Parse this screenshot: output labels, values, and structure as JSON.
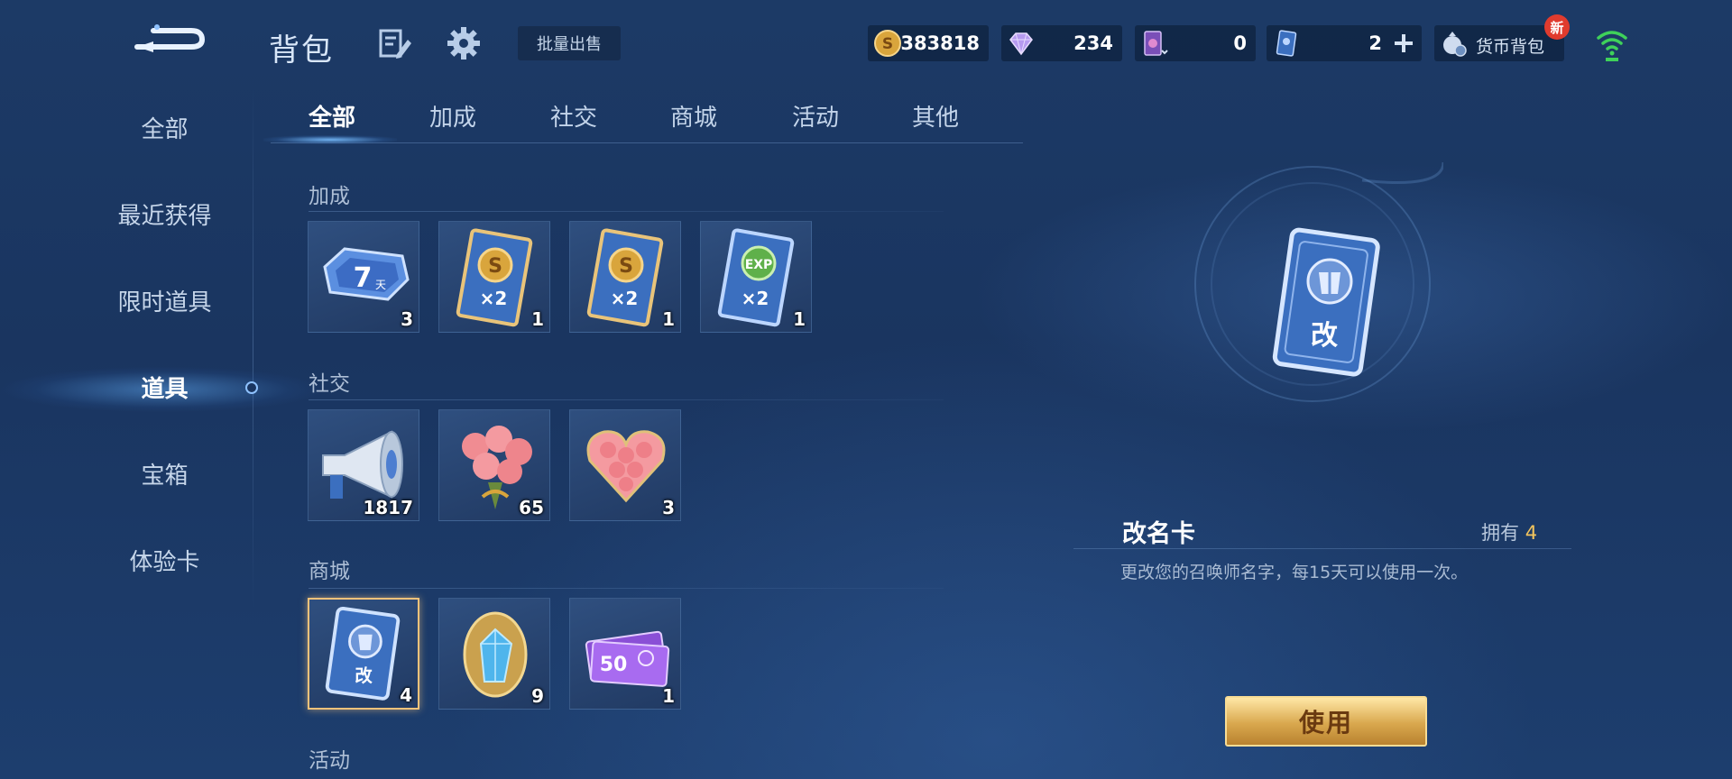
{
  "header": {
    "title": "背包",
    "batch_sell_label": "批量出售",
    "currencies": [
      {
        "icon": "gold-coin-icon",
        "value": "383818"
      },
      {
        "icon": "diamond-icon",
        "value": "234"
      },
      {
        "icon": "ticket-icon",
        "value": "0"
      },
      {
        "icon": "card-icon",
        "value": "2"
      }
    ],
    "currency_bag_label": "货币背包",
    "new_badge": "新"
  },
  "sidebar": {
    "items": [
      {
        "label": "全部"
      },
      {
        "label": "最近获得"
      },
      {
        "label": "限时道具"
      },
      {
        "label": "道具",
        "active": true
      },
      {
        "label": "宝箱"
      },
      {
        "label": "体验卡"
      }
    ]
  },
  "tabs": [
    {
      "label": "全部",
      "active": true
    },
    {
      "label": "加成"
    },
    {
      "label": "社交"
    },
    {
      "label": "商城"
    },
    {
      "label": "活动"
    },
    {
      "label": "其他"
    }
  ],
  "sections": [
    {
      "title": "加成",
      "items": [
        {
          "icon": "seven-day-card-icon",
          "count": "3"
        },
        {
          "icon": "gold-x2-card-icon",
          "count": "1"
        },
        {
          "icon": "gold-x2-card-icon",
          "count": "1"
        },
        {
          "icon": "exp-x2-card-icon",
          "count": "1"
        }
      ]
    },
    {
      "title": "社交",
      "items": [
        {
          "icon": "megaphone-icon",
          "count": "1817"
        },
        {
          "icon": "rose-bouquet-icon",
          "count": "65"
        },
        {
          "icon": "rose-heart-bouquet-icon",
          "count": "3"
        }
      ]
    },
    {
      "title": "商城",
      "items": [
        {
          "icon": "rename-card-icon",
          "count": "4",
          "selected": true
        },
        {
          "icon": "crystal-gem-icon",
          "count": "9"
        },
        {
          "icon": "fifty-coupon-icon",
          "count": "1"
        }
      ]
    },
    {
      "title": "活动",
      "items": []
    }
  ],
  "detail": {
    "name": "改名卡",
    "own_label": "拥有",
    "own_count": "4",
    "description": "更改您的召唤师名字，每15天可以使用一次。",
    "use_label": "使用",
    "card_glyph": "改"
  },
  "item_glyphs": {
    "seven_day": "7",
    "seven_day_unit": "天",
    "x2": "×2",
    "exp": "EXP",
    "fifty": "50"
  },
  "colors": {
    "accent_gold": "#f2c45d",
    "card_blue": "#3b6fbf",
    "selected_border": "#f2c27a"
  }
}
